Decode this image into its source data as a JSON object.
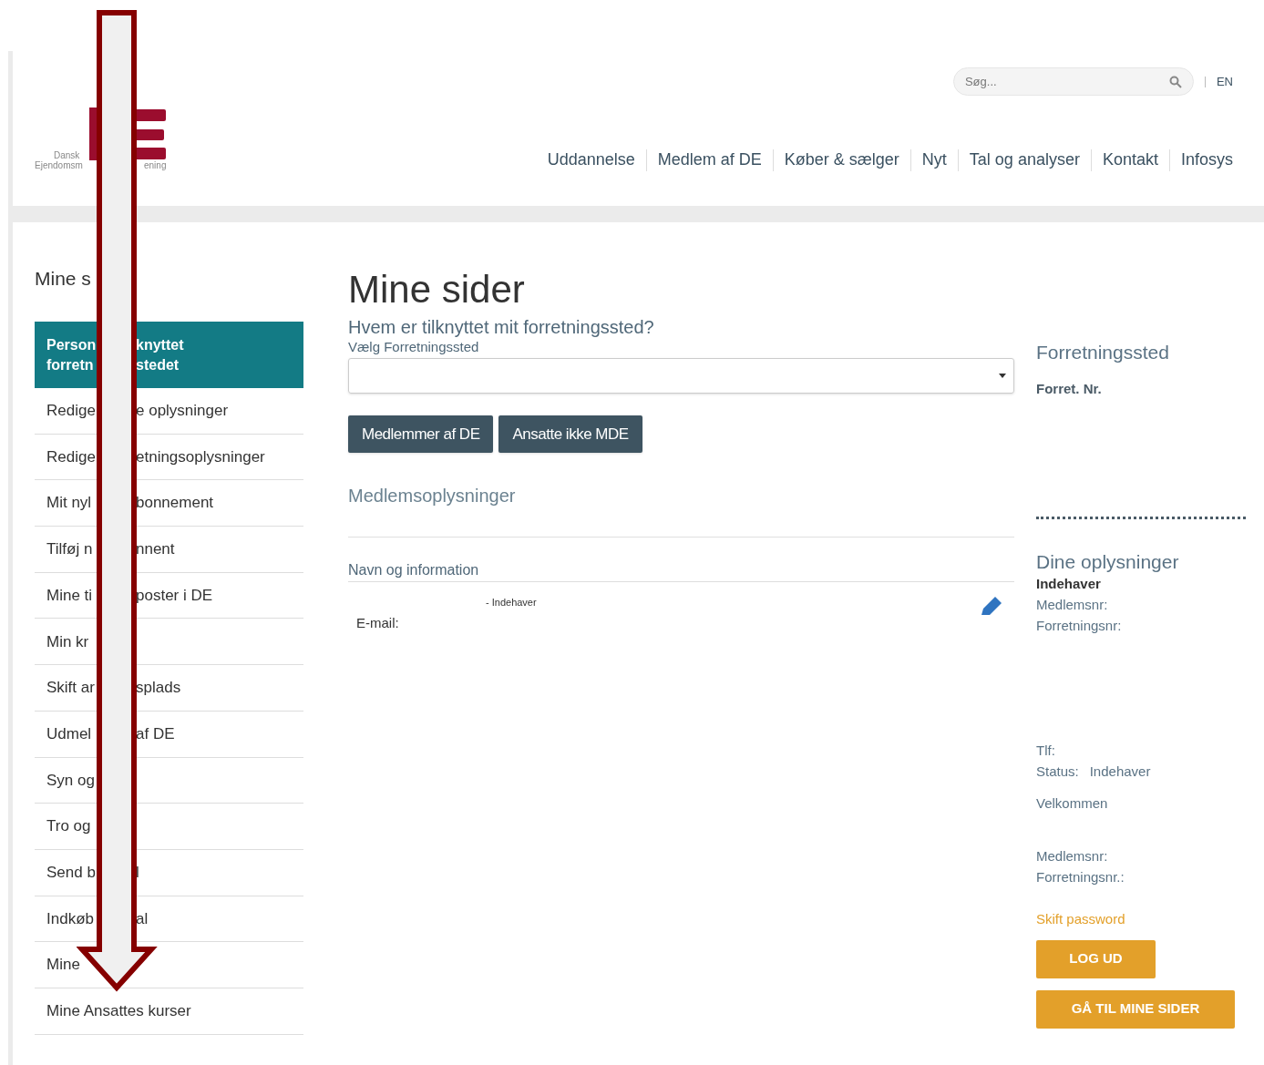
{
  "logo": {
    "line1": "Dansk",
    "line2_left": "Ejendomsm",
    "line2_right": "ening"
  },
  "search": {
    "placeholder": "Søg..."
  },
  "language": "EN",
  "nav": [
    "Uddannelse",
    "Medlem af DE",
    "Køber & sælger",
    "Nyt",
    "Tal og analyser",
    "Kontakt",
    "Infosys"
  ],
  "sidebar": {
    "title": "Mine s",
    "items": [
      {
        "left": "Person\nforretn",
        "right": "knyttet\nstedet",
        "selected": true
      },
      {
        "left": "Redige",
        "right": "e oplysninger",
        "selected": false
      },
      {
        "left": "Redige",
        "right": "etningsoplysninger",
        "selected": false
      },
      {
        "left": "Mit nyl",
        "right": "bonnement",
        "selected": false
      },
      {
        "left": "Tilføj n",
        "right": "nnent",
        "selected": false
      },
      {
        "left": "Mine ti",
        "right": "poster i DE",
        "selected": false
      },
      {
        "left": "Min kr",
        "selected": false
      },
      {
        "left": "Skift ar",
        "right": "splads",
        "selected": false
      },
      {
        "left": "Udmel",
        "right": "af DE",
        "selected": false
      },
      {
        "left": "Syn og",
        "selected": false
      },
      {
        "left": "Tro og",
        "selected": false
      },
      {
        "left": "Send b",
        "right": "l",
        "selected": false
      },
      {
        "left": "Indkøb",
        "right": "al",
        "selected": false
      },
      {
        "left": "Mine",
        "selected": false
      },
      {
        "left": "Mine Ansattes kurser",
        "selected": false
      }
    ]
  },
  "main": {
    "title": "Mine sider",
    "question": "Hvem er tilknyttet mit forretningssted?",
    "select_label": "Vælg Forretningssted",
    "buttons": [
      "Medlemmer af DE",
      "Ansatte ikke MDE"
    ],
    "section": "Medlemsoplysninger",
    "subsection": "Navn og information",
    "role": "- Indehaver",
    "email_label": "E-mail:"
  },
  "aside": {
    "heading": "Forretningssted",
    "forret_nr": "Forret. Nr.",
    "info_heading": "Dine oplysninger",
    "role": "Indehaver",
    "member_no": "Medlemsnr:",
    "business_no": "Forretningsnr:",
    "phone": "Tlf:",
    "status_label": "Status:",
    "status_value": "Indehaver",
    "welcome": "Velkommen",
    "member_no_2": "Medlemsnr:",
    "business_no_2": "Forretningsnr.:",
    "change_password": "Skift password",
    "buttons": [
      "LOG UD",
      "GÅ TIL MINE SIDER"
    ]
  }
}
